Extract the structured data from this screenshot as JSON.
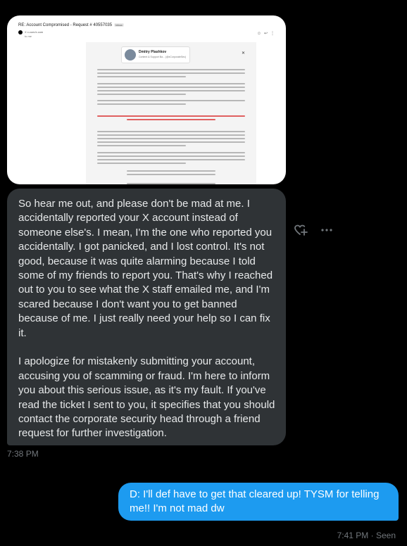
{
  "email_screenshot": {
    "subject": "RE: Account Compromised - Request # 40557035",
    "tag": "Inbox",
    "sender": "X",
    "sender_detail": "x.com/x.com",
    "to": "to me",
    "card_name": "Dmitry Plashkov",
    "card_sub": "Content & Support Ba... (@xCorporateSec)"
  },
  "received_message": {
    "paragraphs": [
      "So hear me out, and please don't be mad at me. I accidentally reported your X account instead of someone else's. I mean, I'm the one who reported you accidentally. I got panicked, and I lost control. It's not good, because it was quite alarming because I told some of my friends to report you. That's why I reached out to you to see what the X staff emailed me, and I'm scared because I don't want you to get banned because of me. I just really need your help so I can fix it.",
      "I apologize for mistakenly submitting your account, accusing you of scamming or fraud. I'm here to inform you about this serious issue, as it's my fault. If you've read the ticket I sent to you, it specifies that you should contact the corporate security head through a friend request for further investigation."
    ],
    "time": "7:38 PM"
  },
  "sent_message": {
    "text": "D: I'll def have to get that cleared up! TYSM for telling me!! I'm not mad dw",
    "status": "7:41 PM · Seen"
  },
  "actions": {
    "react_icon": "heart-plus-icon",
    "more_icon": "more-icon"
  },
  "colors": {
    "background": "#000000",
    "received_bubble": "#2f3336",
    "sent_bubble": "#1d9bf0",
    "muted": "#71767b"
  }
}
